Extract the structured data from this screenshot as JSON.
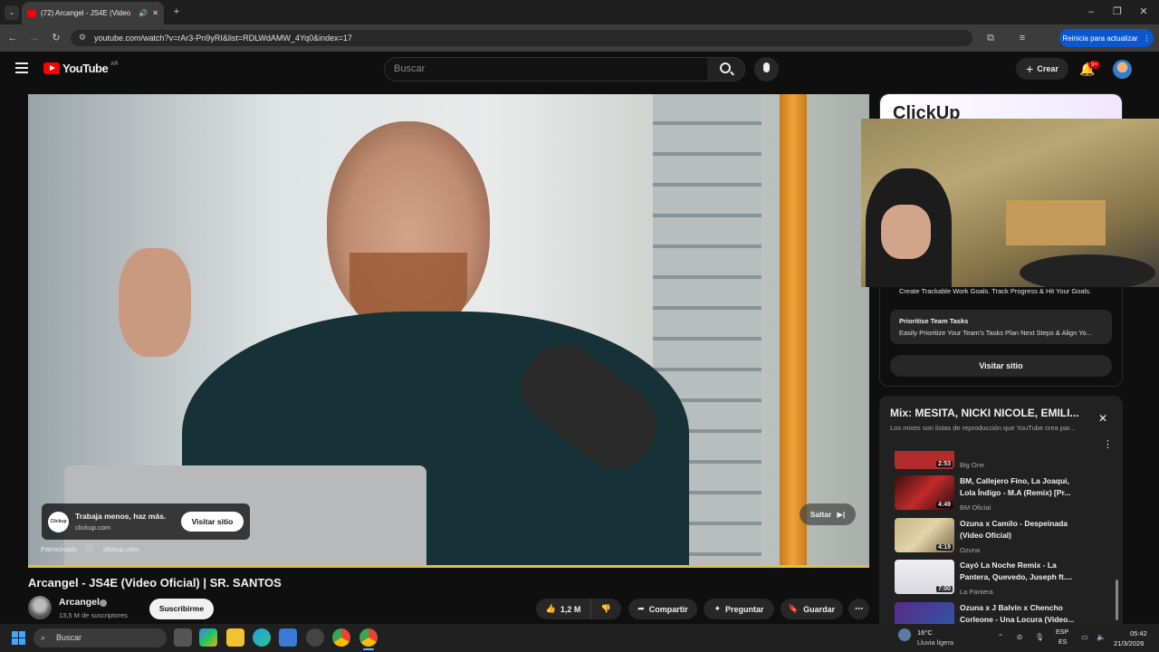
{
  "browser": {
    "tab_title": "(72) Arcangel - JS4E (Video",
    "url": "youtube.com/watch?v=rAr3-Pn9yRI&list=RDLWdAMW_4Yq0&index=17",
    "update_button": "Reinicia para actualizar"
  },
  "yt": {
    "logo": "YouTube",
    "country": "AR",
    "search_placeholder": "Buscar",
    "create": "Crear",
    "notif_count": "9+"
  },
  "ad": {
    "headline": "Trabaja menos, haz más.",
    "domain": "clickup.com",
    "visit": "Visitar sitio",
    "sponsored": "Patrocinado",
    "sponsor_domain": "clickup.com",
    "skip": "Saltar",
    "brand_badge": "Clickup"
  },
  "side_ad": {
    "banner_brand": "ClickUp",
    "item1_desc": "Create Trackable Work Goals. Track Progress & Hit Your Goals.",
    "item2_title": "Prioritise Team Tasks",
    "item2_desc": "Easily Prioritize Your Team's Tasks Plan Next Steps & Align Yo...",
    "visit": "Visitar sitio"
  },
  "mix": {
    "title": "Mix: MESITA, NICKI NICOLE, EMILI...",
    "subtitle": "Los mixes son listas de reproducción que YouTube crea par...",
    "items": [
      {
        "title": "",
        "channel": "Big One",
        "duration": "2:53"
      },
      {
        "title": "BM, Callejero Fino, La Joaqui, Lola Índigo - M.A (Remix) [Pr...",
        "channel": "BM Oficial",
        "duration": "4:49"
      },
      {
        "title": "Ozuna x Camilo - Despeinada (Video Oficial)",
        "channel": "Ozuna",
        "duration": "4:19"
      },
      {
        "title": "Cayó La Noche Remix - La Pantera, Quevedo, Juseph ft....",
        "channel": "La Pantera",
        "duration": "7:00"
      },
      {
        "title": "Ozuna x J Balvin x Chencho Corleone - Una Locura (Video...",
        "channel": "",
        "duration": ""
      }
    ]
  },
  "video": {
    "title": "Arcangel - JS4E (Video Oficial) | SR. SANTOS",
    "channel": "Arcangel",
    "subs": "13,5 M de suscriptores",
    "subscribe": "Suscribirme",
    "likes": "1,2 M",
    "share": "Compartir",
    "ask": "Preguntar",
    "save": "Guardar"
  },
  "taskbar": {
    "search": "Buscar",
    "temp": "16°C",
    "weather": "Lluvia ligera",
    "lang1": "ESP",
    "lang2": "ES",
    "time": "05:42",
    "date": "21/3/2026"
  }
}
